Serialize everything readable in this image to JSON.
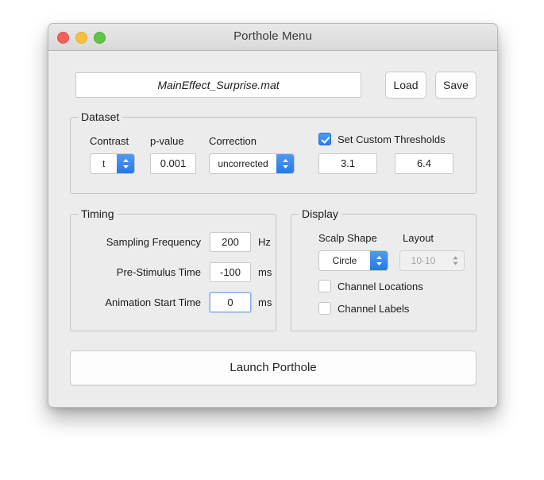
{
  "window": {
    "title": "Porthole Menu",
    "traffic_lights": [
      "close-button",
      "minimize-button",
      "zoom-button"
    ]
  },
  "file_row": {
    "filename": "MainEffect_Surprise.mat",
    "load_label": "Load",
    "save_label": "Save"
  },
  "dataset": {
    "title": "Dataset",
    "contrast_label": "Contrast",
    "contrast_value": "t",
    "pvalue_label": "p-value",
    "pvalue_value": "0.001",
    "correction_label": "Correction",
    "correction_value": "uncorrected",
    "custom_thresholds_label": "Set Custom Thresholds",
    "custom_thresholds_checked": true,
    "threshold_min": "3.1",
    "threshold_max": "6.4"
  },
  "timing": {
    "title": "Timing",
    "rows": [
      {
        "label": "Sampling Frequency",
        "value": "200",
        "unit": "Hz",
        "focused": false
      },
      {
        "label": "Pre-Stimulus Time",
        "value": "-100",
        "unit": "ms",
        "focused": false
      },
      {
        "label": "Animation Start Time",
        "value": "0",
        "unit": "ms",
        "focused": true
      }
    ]
  },
  "display": {
    "title": "Display",
    "scalp_shape_label": "Scalp Shape",
    "scalp_shape_value": "Circle",
    "layout_label": "Layout",
    "layout_value": "10-10",
    "layout_disabled": true,
    "channel_locations_label": "Channel Locations",
    "channel_locations_checked": false,
    "channel_labels_label": "Channel Labels",
    "channel_labels_checked": false
  },
  "footer": {
    "launch_label": "Launch Porthole"
  },
  "colors": {
    "accent_blue": "#2a7ced",
    "window_bg": "#ececec",
    "titlebar_bg": "#dedede",
    "light_red": "#f2615c",
    "light_yellow": "#f7c043",
    "light_green": "#63c548"
  }
}
